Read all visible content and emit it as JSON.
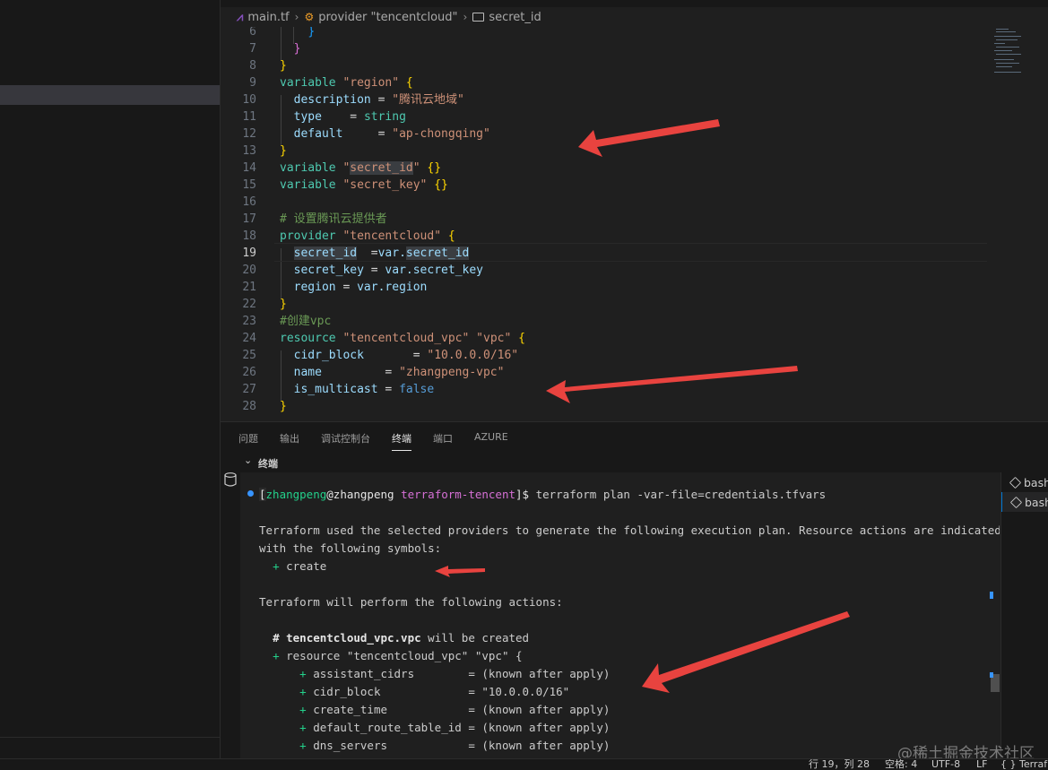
{
  "breadcrumb": {
    "file": "main.tf",
    "provider": "provider \"tencentcloud\"",
    "field": "secret_id"
  },
  "editor": {
    "current_line": "19",
    "lines": [
      {
        "n": "6"
      },
      {
        "n": "7"
      },
      {
        "n": "8"
      },
      {
        "n": "9"
      },
      {
        "n": "10"
      },
      {
        "n": "11"
      },
      {
        "n": "12"
      },
      {
        "n": "13"
      },
      {
        "n": "14"
      },
      {
        "n": "15"
      },
      {
        "n": "16"
      },
      {
        "n": "17"
      },
      {
        "n": "18"
      },
      {
        "n": "19"
      },
      {
        "n": "20"
      },
      {
        "n": "21"
      },
      {
        "n": "22"
      },
      {
        "n": "23"
      },
      {
        "n": "24"
      },
      {
        "n": "25"
      },
      {
        "n": "26"
      },
      {
        "n": "27"
      },
      {
        "n": "28"
      }
    ],
    "t": {
      "l6": "}",
      "l7": "}",
      "l8": "}",
      "l9a": "variable",
      "l9b": "\"region\"",
      "l9c": "{",
      "l10a": "description",
      "l10b": " = ",
      "l10c": "\"腾讯云地域\"",
      "l11a": "type",
      "l11b": "    = ",
      "l11c": "string",
      "l12a": "default",
      "l12b": "     = ",
      "l12c": "\"ap-chongqing\"",
      "l13": "}",
      "l14a": "variable",
      "l14b": "\"",
      "l14c": "secret_id",
      "l14d": "\"",
      "l14e": "{}",
      "l15a": "variable",
      "l15b": "\"secret_key\"",
      "l15c": "{}",
      "l17": "# 设置腾讯云提供者",
      "l18a": "provider",
      "l18b": "\"tencentcloud\"",
      "l18c": "{",
      "l19a": "secret_id",
      "l19b": "  =",
      "l19c": "var.",
      "l19d": "secret_id",
      "l20a": "secret_key",
      "l20b": " = ",
      "l20c": "var.secret_key",
      "l21a": "region",
      "l21b": " = ",
      "l21c": "var.region",
      "l22": "}",
      "l23": "#创建vpc",
      "l24a": "resource",
      "l24b": "\"tencentcloud_vpc\"",
      "l24c": "\"vpc\"",
      "l24d": "{",
      "l25a": "cidr_block",
      "l25b": "       = ",
      "l25c": "\"10.0.0.0/16\"",
      "l26a": "name",
      "l26b": "         = ",
      "l26c": "\"zhangpeng-vpc\"",
      "l27a": "is_multicast",
      "l27b": " = ",
      "l27c": "false",
      "l28": "}"
    }
  },
  "panel": {
    "tabs": [
      "问题",
      "输出",
      "调试控制台",
      "终端",
      "端口",
      "AZURE"
    ],
    "active_tab": "终端",
    "terminal_title": "终端"
  },
  "terminal": {
    "prompt": {
      "open": "[",
      "user": "zhangpeng",
      "at": "@",
      "host": "zhangpeng",
      "dir": "terraform-tencent",
      "close": "]$ ",
      "command": "terraform plan -var-file=credentials.tfvars"
    },
    "out1": "Terraform used the selected providers to generate the following execution plan. Resource actions are indicated",
    "out2": "with the following symbols:",
    "sym_plus": "+",
    "sym_create": " create",
    "out3": "Terraform will perform the following actions:",
    "res_hash": "# ",
    "res_name": "tencentcloud_vpc.vpc",
    "res_tail": " will be created",
    "res_plus": "+",
    "res_decl": " resource \"tencentcloud_vpc\" \"vpc\" {",
    "attrs": [
      {
        "name": "assistant_cidrs",
        "value": "= (known after apply)"
      },
      {
        "name": "cidr_block",
        "value": "= \"10.0.0.0/16\""
      },
      {
        "name": "create_time",
        "value": "= (known after apply)"
      },
      {
        "name": "default_route_table_id",
        "value": "= (known after apply)"
      },
      {
        "name": "dns_servers",
        "value": "= (known after apply)"
      }
    ]
  },
  "terminal_list": [
    {
      "label": "bash"
    },
    {
      "label": "bash"
    }
  ],
  "status": {
    "position": "行 19，列 28",
    "spaces": "空格: 4",
    "encoding": "UTF-8",
    "eol": "LF",
    "language": "{ } Terraf"
  },
  "watermark": "@稀土掘金技术社区",
  "colors": {
    "arrow": "#e8433f",
    "accent": "#0078d4",
    "terminal_blue_dot": "#3794ff"
  }
}
